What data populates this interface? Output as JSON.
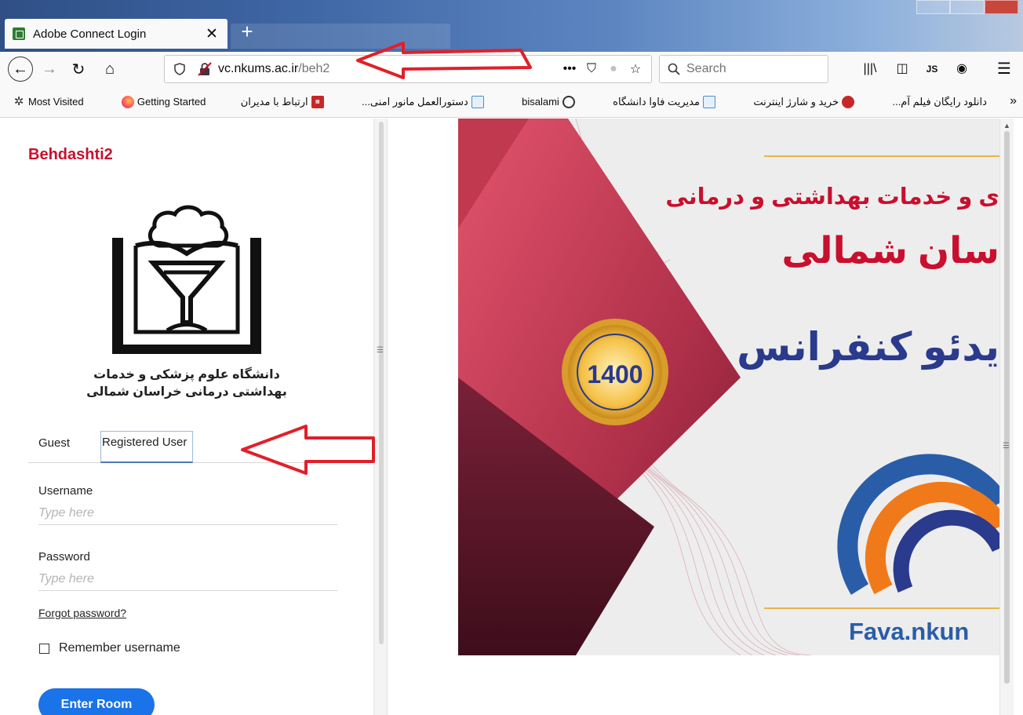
{
  "browser": {
    "tab_title": "Adobe Connect Login",
    "tab_close": "✕",
    "new_tab": "+",
    "url_domain": "vc.nkums.ac.ir",
    "url_path": "/beh2",
    "url_actions": {
      "more": "•••",
      "pocket": "⛉",
      "star": "☆"
    },
    "search_placeholder": "Search",
    "toolbar_icons": {
      "library": "|||\\",
      "sidebar": "◫",
      "js": "JS",
      "account": "◉",
      "menu": "☰"
    },
    "nav_icons": {
      "back": "←",
      "forward": "→",
      "reload": "↻",
      "home": "⌂"
    }
  },
  "bookmarks": {
    "overflow": "»",
    "items": [
      {
        "label": "Most Visited",
        "icon": "gear-icon"
      },
      {
        "label": "Getting Started",
        "icon": "firefox-icon"
      },
      {
        "label": "ارتباط با مدیران",
        "icon": "news-icon"
      },
      {
        "label": "دستورالعمل مانور امنی...",
        "icon": "university-icon"
      },
      {
        "label": "bisalami",
        "icon": "globe-icon"
      },
      {
        "label": "مدیریت فاوا دانشگاه",
        "icon": "university-icon"
      },
      {
        "label": "خرید و شارژ اینترنت",
        "icon": "university-icon"
      },
      {
        "label": "دانلود رایگان فیلم آم...",
        "icon": "red-circle-icon"
      }
    ]
  },
  "login": {
    "room_name": "Behdashti2",
    "university_name_line1": "دانشگاه علوم پزشکی و خدمات",
    "university_name_line2": "بهداشتی درمانی خراسان شمالی",
    "tabs": {
      "guest": "Guest",
      "registered": "Registered User"
    },
    "username_label": "Username",
    "username_placeholder": "Type here",
    "password_label": "Password",
    "password_placeholder": "Type here",
    "forgot_password": "Forgot password?",
    "remember_label": "Remember username",
    "enter_button": "Enter Room"
  },
  "banner": {
    "line1": "ی و خدمات بهداشتی و درمانی",
    "line2": "سان شمالی",
    "line3": "یدئو کنفرانس",
    "year": "1400",
    "fava_url": "Fava.nkun",
    "colors": {
      "red": "#c8102e",
      "navy": "#2a3a8c",
      "blue": "#2a5da8",
      "orange": "#f07a1a"
    }
  }
}
